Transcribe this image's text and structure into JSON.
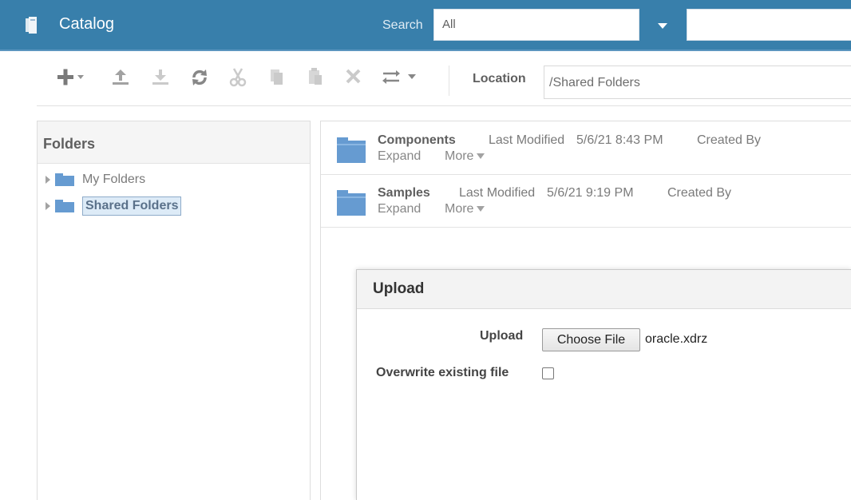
{
  "header": {
    "title": "Catalog",
    "search_label": "Search",
    "search_scope": "All",
    "search_query": "",
    "icons": [
      "catalog-icon",
      "dropdown-arrow-icon"
    ]
  },
  "toolbar": {
    "location_label": "Location",
    "location_value": "/Shared Folders",
    "buttons": [
      "new-icon",
      "upload-icon",
      "download-icon",
      "refresh-icon",
      "cut-icon",
      "copy-icon",
      "paste-icon",
      "delete-icon",
      "swap-icon"
    ]
  },
  "folders": {
    "title": "Folders",
    "items": [
      {
        "label": "My Folders",
        "selected": false
      },
      {
        "label": "Shared Folders",
        "selected": true
      }
    ]
  },
  "content": {
    "items": [
      {
        "name": "Components",
        "modified_label": "Last Modified",
        "modified": "5/6/21 8:43 PM",
        "created_label": "Created By",
        "expand": "Expand",
        "more": "More"
      },
      {
        "name": "Samples",
        "modified_label": "Last Modified",
        "modified": "5/6/21 9:19 PM",
        "created_label": "Created By",
        "expand": "Expand",
        "more": "More"
      }
    ]
  },
  "dialog": {
    "title": "Upload",
    "upload_label": "Upload",
    "choose_button": "Choose File",
    "file_name": "oracle.xdrz",
    "overwrite_label": "Overwrite existing file",
    "overwrite_checked": false
  },
  "colors": {
    "header_bg": "#005b94",
    "folder_icon": "#3b7fc4",
    "selected_bg": "#d4e6f5"
  }
}
